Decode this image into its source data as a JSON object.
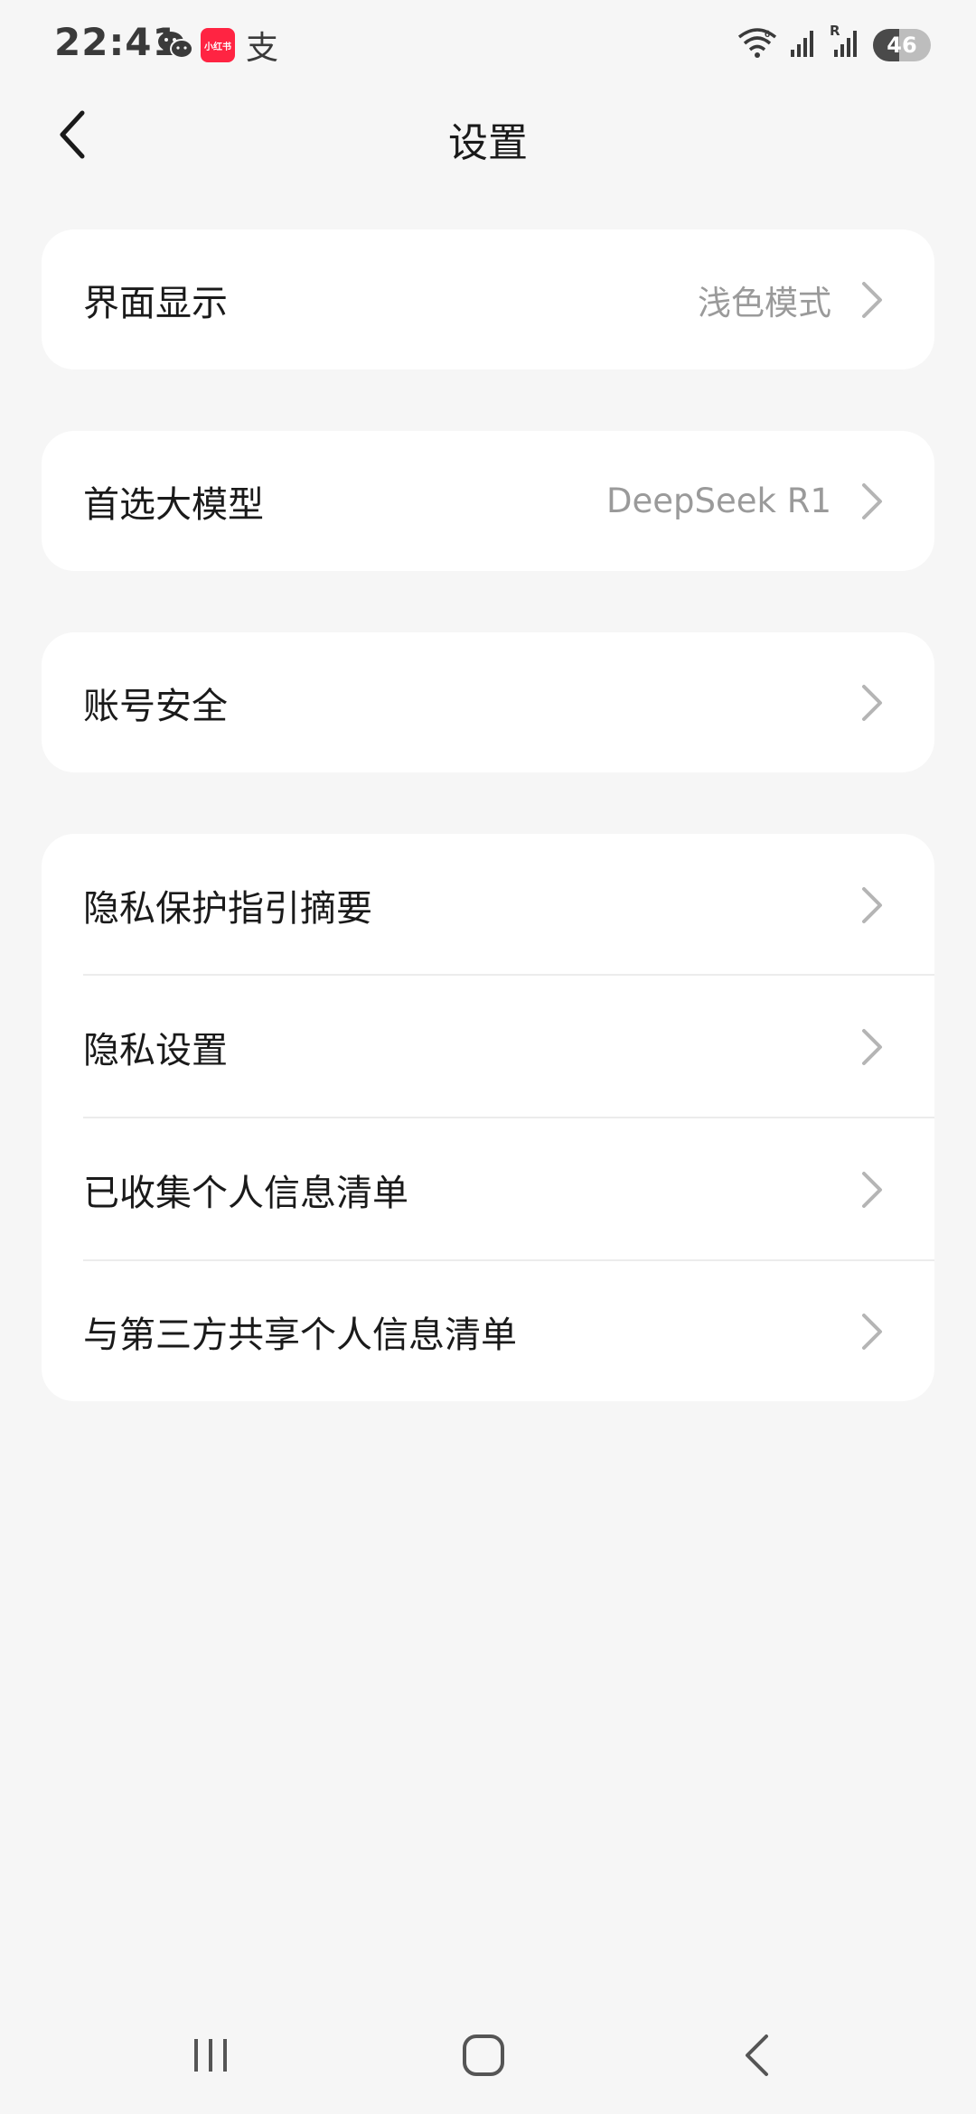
{
  "status_bar": {
    "time": "22:41",
    "apps": [
      {
        "icon": "wechat-icon"
      },
      {
        "icon": "xiaohongshu-icon",
        "text": "小红书",
        "color": "#ff2442"
      },
      {
        "icon": "alipay-icon",
        "text": "支"
      }
    ],
    "wifi_icon": "wifi-6-icon",
    "signal_icons": [
      "signal-icon",
      "signal-roaming-icon"
    ],
    "roaming_label": "R",
    "battery": {
      "level": "46",
      "fill_fraction": 0.46
    }
  },
  "header": {
    "back_icon": "back-arrow-icon",
    "title": "设置"
  },
  "settings": {
    "display": {
      "label": "界面显示",
      "value": "浅色模式"
    },
    "model": {
      "label": "首选大模型",
      "value": "DeepSeek R1"
    },
    "account": {
      "label": "账号安全"
    },
    "privacy": [
      {
        "label": "隐私保护指引摘要"
      },
      {
        "label": "隐私设置"
      },
      {
        "label": "已收集个人信息清单"
      },
      {
        "label": "与第三方共享个人信息清单"
      }
    ]
  },
  "nav_bar": {
    "recents_icon": "recents-icon",
    "home_icon": "home-icon",
    "back_icon": "back-icon"
  },
  "colors": {
    "background": "#f6f6f6",
    "card": "#ffffff",
    "secondary_text": "#9a9a9a",
    "chevron": "#b5b5b5"
  }
}
